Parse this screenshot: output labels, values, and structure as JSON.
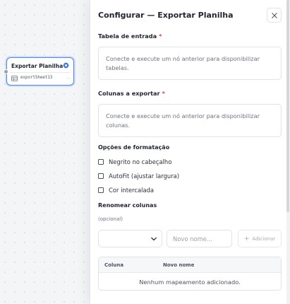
{
  "node": {
    "title": "Exportar Planilha",
    "subtitle": "exportSheet13",
    "more": "…",
    "icons": {
      "settings": "gear-icon",
      "table": "table-icon"
    },
    "accent": "#4a86e8"
  },
  "panel": {
    "title": "Configurar — Exportar Planilha",
    "close_label": "×",
    "input_table": {
      "label": "Tabela de entrada",
      "required": "*",
      "message": "Conecte e execute um nó anterior para disponibilizar tabelas."
    },
    "export_columns": {
      "label": "Colunas a exportar",
      "required": "*",
      "message": "Conecte e execute um nó anterior para disponibilizar colunas."
    },
    "formatting": {
      "title": "Opções de formatação",
      "options": [
        {
          "label": "Negrito no cabeçalho",
          "checked": false
        },
        {
          "label": "AutoFit (ajustar largura)",
          "checked": false
        },
        {
          "label": "Cor intercalada",
          "checked": false
        }
      ]
    },
    "rename": {
      "title": "Renomear colunas",
      "hint": "(opcional)",
      "select_value": "",
      "new_name_placeholder": "Novo nome...",
      "new_name_value": "",
      "add_label": "Adicionar",
      "table": {
        "columns": [
          "Coluna",
          "Novo nome"
        ],
        "empty_message": "Nenhum mapeamento adicionado."
      }
    },
    "required_color": "#e0403a"
  }
}
